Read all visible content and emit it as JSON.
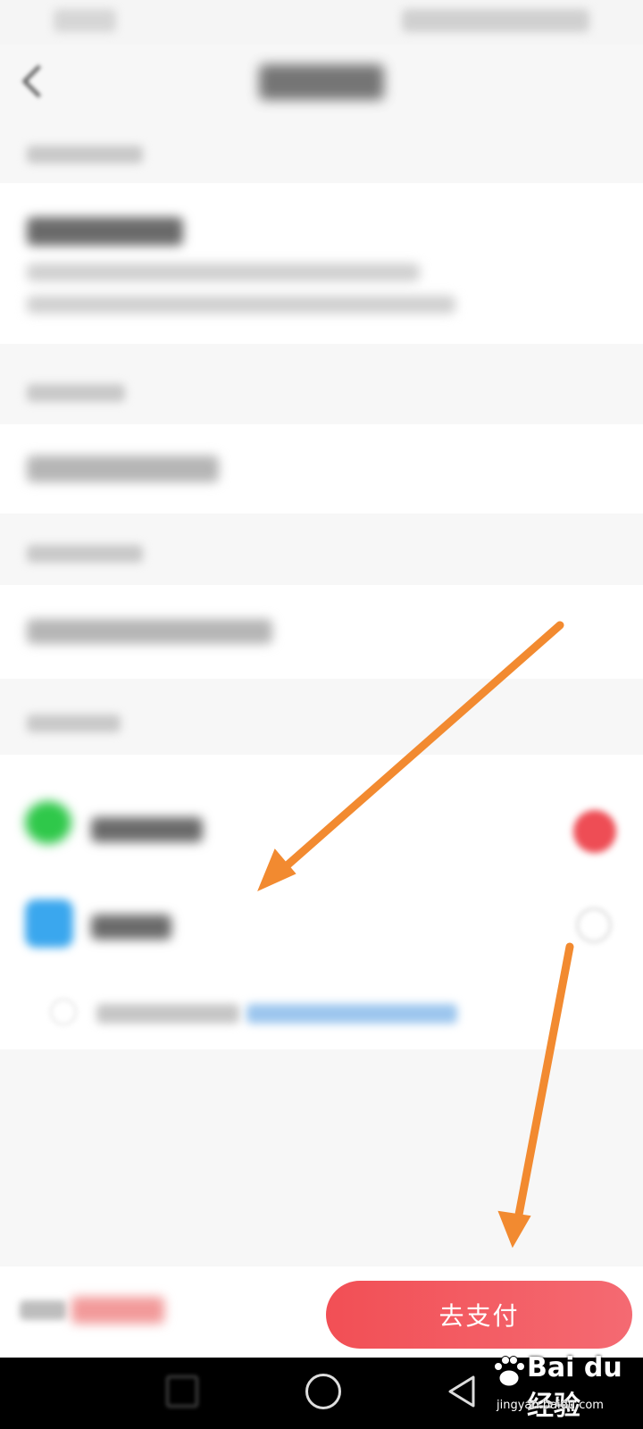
{
  "bottom_bar": {
    "pay_button_label": "去支付"
  },
  "watermark": {
    "brand": "Bai du 经验",
    "domain": "jingyan.baidu.com"
  },
  "colors": {
    "pay_button": "#f24f55",
    "selected_radio": "#ee4d55",
    "wechat_icon": "#2fc84a",
    "alipay_icon": "#3aa7ee",
    "annotation_arrow": "#f28a30"
  },
  "icons": {
    "wechat": "wechat-pay-icon",
    "alipay": "alipay-icon",
    "back": "chevron-left-icon"
  }
}
